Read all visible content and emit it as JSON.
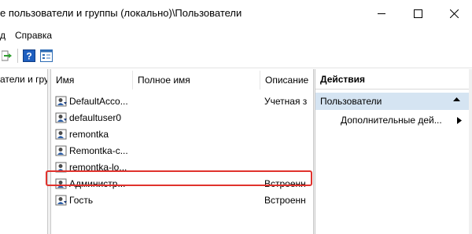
{
  "window": {
    "title": "е пользователи и группы (локально)\\Пользователи",
    "controls": [
      "minimize",
      "maximize",
      "close"
    ]
  },
  "menu": {
    "items": [
      {
        "label": "д"
      },
      {
        "label": "Справка"
      }
    ]
  },
  "toolbar": {
    "buttons": [
      "export-icon",
      "help-icon",
      "properties-icon"
    ]
  },
  "tree": {
    "item_label": "атели и гру"
  },
  "list": {
    "columns": {
      "name": "Имя",
      "full_name": "Полное имя",
      "description": "Описание"
    },
    "rows": [
      {
        "name": "DefaultAcco...",
        "description": "Учетная з"
      },
      {
        "name": "defaultuser0",
        "description": ""
      },
      {
        "name": "remontka",
        "description": ""
      },
      {
        "name": "Remontka-c...",
        "description": ""
      },
      {
        "name": "remontka-lo...",
        "description": ""
      },
      {
        "name": "Администр...",
        "description": "Встроенн",
        "highlighted": true
      },
      {
        "name": "Гость",
        "description": "Встроенн"
      }
    ]
  },
  "actions": {
    "header": "Действия",
    "section": "Пользователи",
    "item": "Дополнительные дей..."
  },
  "colors": {
    "highlight_border": "#e0322d",
    "actions_section_bg": "#d5e4f2"
  }
}
